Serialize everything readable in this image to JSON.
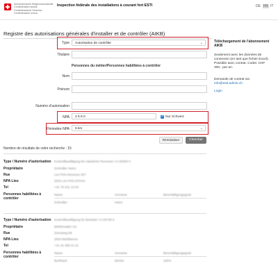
{
  "header": {
    "confederation_lines": [
      "Schweizerische Eidgenossenschaft",
      "Confédération suisse",
      "Confederazione Svizzera",
      "Confederaziun svizra"
    ],
    "agency_title": "Inspection fédérale des installations à courant fort ESTI",
    "languages": [
      "DE",
      "FR",
      "IT"
    ],
    "active_language": "FR"
  },
  "page": {
    "title": "Registre des autorisations générales d'installer et de contrôler (AIKB)"
  },
  "form": {
    "type_label": "Type",
    "type_value": "Autorisation de contrôler",
    "titulaire_label": "Titulaire",
    "section_persons": "Personnes du métier/Personnes habilitées à contrôler",
    "nom_label": "Nom",
    "prenom_label": "Prénom",
    "numero_label": "Numéro d'autorisation",
    "npa_label": "NPA",
    "npa_value": "2 5 6 0",
    "nur_schweiz_label": "Nur Schweiz",
    "perimetre_label": "Périmètre NPA",
    "perimetre_value": "5 km",
    "reset_label": "Réinitialiser",
    "search_label": "Chercher"
  },
  "results": {
    "count_text": "Nombre de résultats de votre recherche : 15",
    "labels": {
      "type": "Type / Numéro d'autorisation",
      "owner": "Propriétaire",
      "street": "Rue",
      "npa_locality": "NPA Lieu",
      "tel": "Tel",
      "persons": "Personnes habilitées à contrôler"
    },
    "items": [
      {
        "type": "Kontrollbewilligung für natürliche Personen / K-00000 0",
        "owner": "Schindler Heinz",
        "street": "Les Prés-Dessous 267",
        "npa_locality": "2534 Les Prés-d'Orvin",
        "tel": "+41 79 231 13 04",
        "table_head": [
          "Name",
          "Vorname",
          "Beschäftigungsgrad"
        ],
        "table_row": [
          "Schindler",
          "Heinz",
          ""
        ]
      },
      {
        "type": "Kontrollbewilligung für Betriebe / K-00736 0",
        "owner": "Möhlematter AG",
        "street": "Zionsweg 99",
        "npa_locality": "2503 Biel/Bienne",
        "tel": "+41 32 365 01 01",
        "table_head": [
          "Name",
          "Vorname",
          "Beschäftigungsgrad"
        ],
        "table_row": [
          "Burkhard",
          "Michel",
          "100%"
        ]
      }
    ]
  },
  "sidebar": {
    "title": "Téléchargement de l'abonnement AIKB",
    "text": "Seulement avec les données de connexion (en tant que fichier Excel). Possible avec contrat. Coûts: CHF 300.- par an.",
    "contract_text": "Demande de contrat via",
    "email": "info@esti.admin.ch",
    "login": "Login"
  }
}
